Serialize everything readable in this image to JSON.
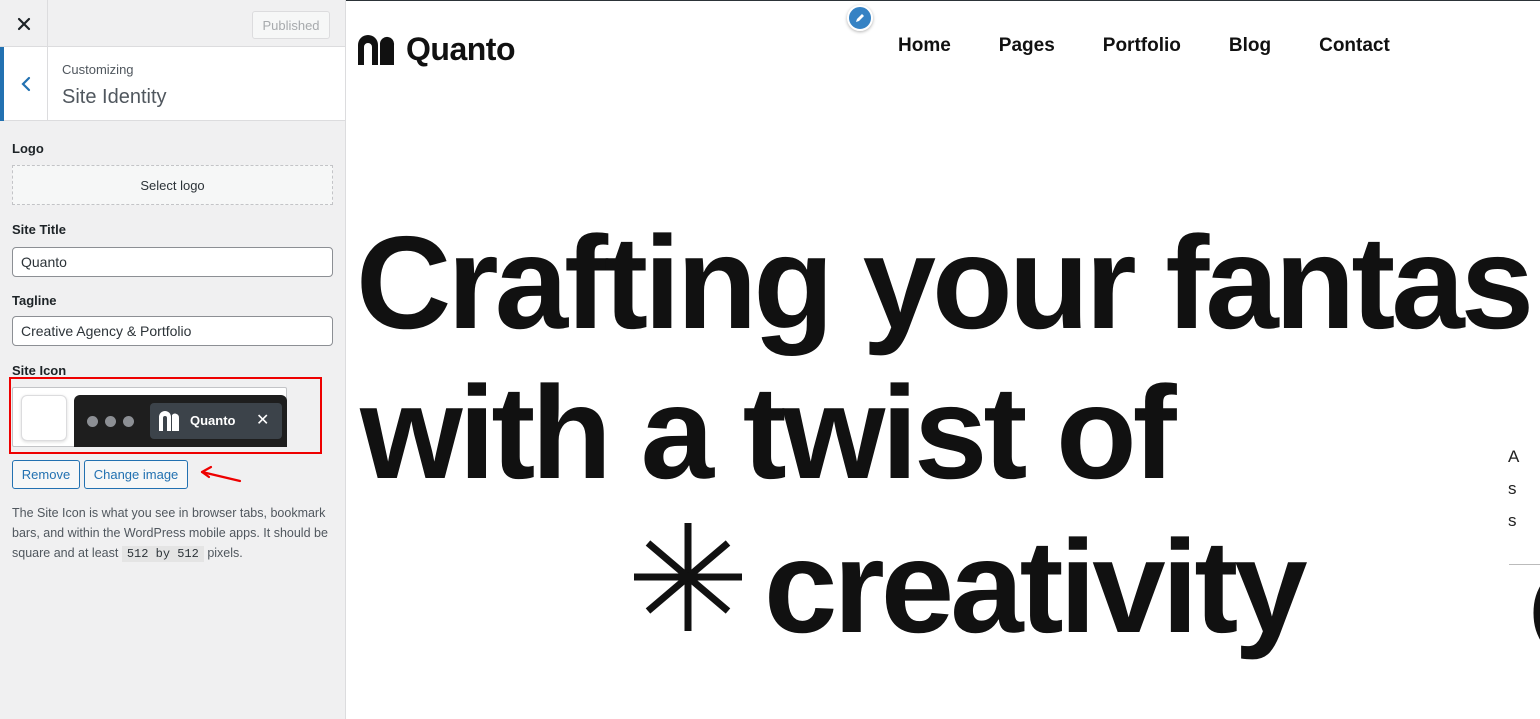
{
  "customizer": {
    "publish_label": "Published",
    "customizing_label": "Customizing",
    "section_title": "Site Identity",
    "logo": {
      "label": "Logo",
      "select_label": "Select logo"
    },
    "site_title": {
      "label": "Site Title",
      "value": "Quanto"
    },
    "tagline": {
      "label": "Tagline",
      "value": "Creative Agency & Portfolio"
    },
    "site_icon": {
      "label": "Site Icon",
      "preview_tab_name": "Quanto",
      "remove_label": "Remove",
      "change_label": "Change image",
      "help_part1": "The Site Icon is what you see in browser tabs, bookmark bars, and within the WordPress mobile apps. It should be square and at least",
      "help_code": "512 by 512",
      "help_part2": "pixels."
    },
    "accent_color": "#2271b1",
    "highlight_color": "#e00000"
  },
  "preview": {
    "brand_name": "Quanto",
    "nav": [
      "Home",
      "Pages",
      "Portfolio",
      "Blog",
      "Contact"
    ],
    "hero": {
      "line1": "Crafting your fantas",
      "line2": "with a twist of",
      "line3": "creativity"
    },
    "side_fragments": [
      "A",
      "s",
      "s",
      "("
    ]
  }
}
